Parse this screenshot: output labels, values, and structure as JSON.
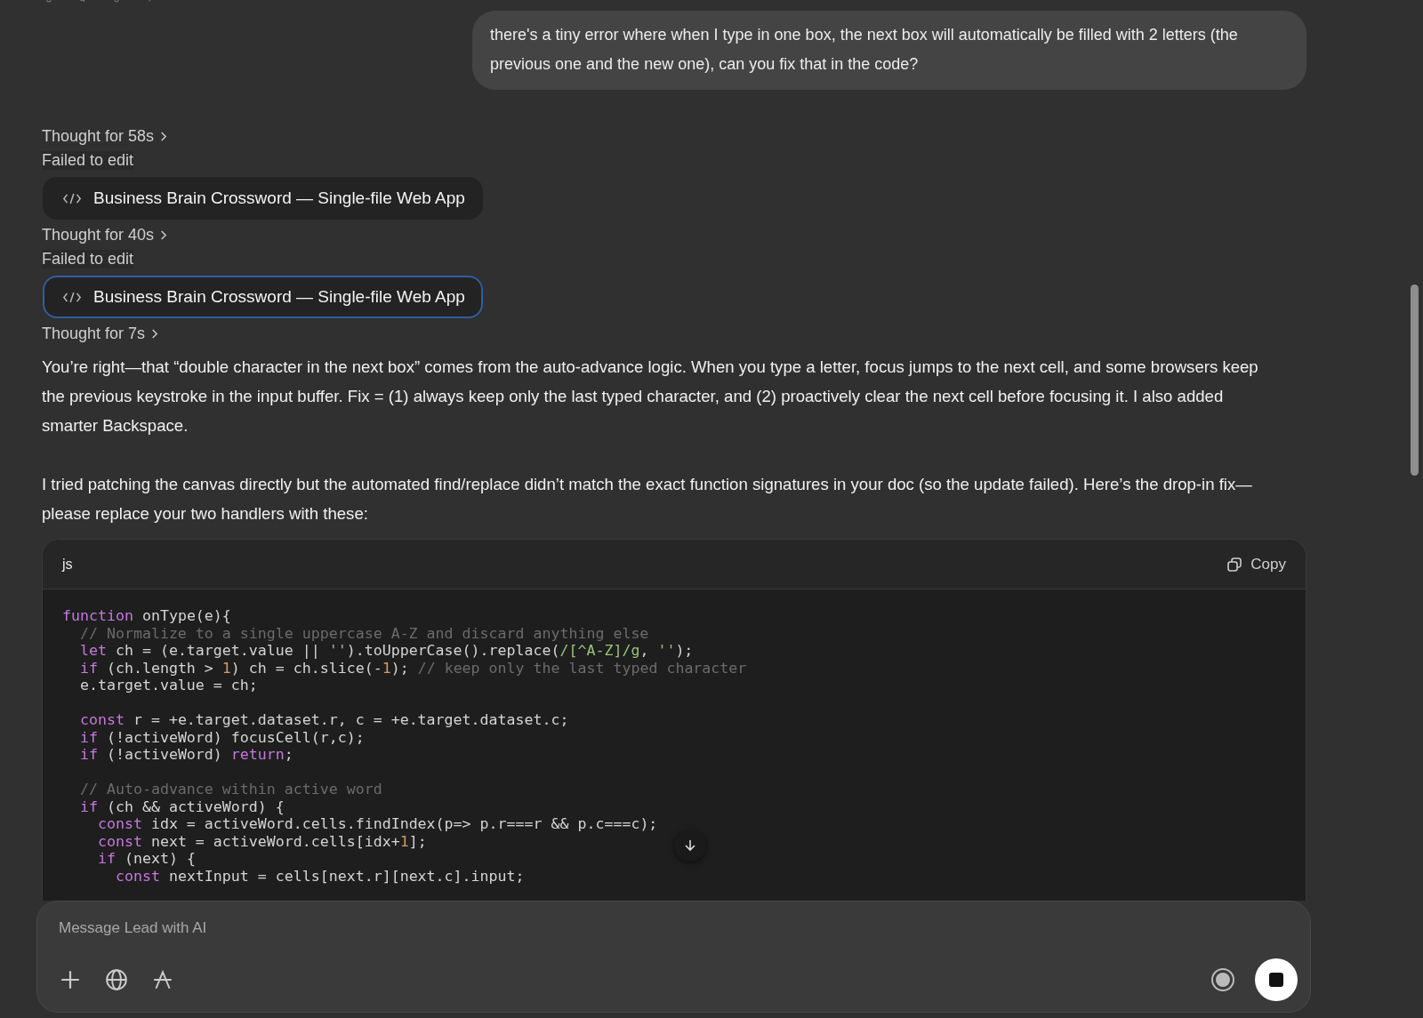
{
  "user_message": {
    "text": "there's a tiny error where when I type in one box, the next box will automatically be filled with 2 letters (the previous one and the new one), can you fix that in the code?"
  },
  "activity": [
    {
      "kind": "thought",
      "text": "Thought for 58s"
    },
    {
      "kind": "status",
      "text": "Failed to edit"
    },
    {
      "kind": "artifact",
      "text": "Business Brain Crossword — Single-file Web App",
      "selected": false
    },
    {
      "kind": "thought",
      "text": "Thought for 40s"
    },
    {
      "kind": "status",
      "text": "Failed to edit"
    },
    {
      "kind": "artifact",
      "text": "Business Brain Crossword — Single-file Web App",
      "selected": true
    },
    {
      "kind": "thought",
      "text": "Thought for 7s"
    }
  ],
  "paragraphs": [
    "You’re right—that “double character in the next box” comes from the auto-advance logic. When you type a letter, focus jumps to the next cell, and some browsers keep the previous keystroke in the input buffer. Fix = (1) always keep only the last typed character, and (2) proactively clear the next cell before focusing it. I also added smarter Backspace.",
    "I tried patching the canvas directly but the automated find/replace didn’t match the exact function signatures in your doc (so the update failed). Here’s the drop-in fix—please replace your two handlers with these:"
  ],
  "code_block": {
    "language": "js",
    "copy_label": "Copy",
    "blocks": [
      [
        [
          {
            "kind": "kw",
            "t": "function"
          },
          {
            "kind": "plain",
            "t": " onType(e){"
          }
        ],
        [
          {
            "kind": "comment",
            "t": "  // Normalize to a single uppercase A-Z and discard anything else"
          }
        ],
        [
          {
            "kind": "kw",
            "t": "  let"
          },
          {
            "kind": "plain",
            "t": " ch = (e.target.value || "
          },
          {
            "kind": "str",
            "t": "''"
          },
          {
            "kind": "plain",
            "t": ").toUpperCase().replace("
          },
          {
            "kind": "str",
            "t": "/[^A-Z]/g"
          },
          {
            "kind": "plain",
            "t": ", "
          },
          {
            "kind": "str",
            "t": "''"
          },
          {
            "kind": "plain",
            "t": ");"
          }
        ],
        [
          {
            "kind": "kw",
            "t": "  if"
          },
          {
            "kind": "plain",
            "t": " (ch.length > "
          },
          {
            "kind": "num",
            "t": "1"
          },
          {
            "kind": "plain",
            "t": ") ch = ch.slice(-"
          },
          {
            "kind": "num",
            "t": "1"
          },
          {
            "kind": "plain",
            "t": "); "
          },
          {
            "kind": "comment",
            "t": "// keep only the last typed character"
          }
        ],
        [
          {
            "kind": "plain",
            "t": "  e.target.value = ch;"
          }
        ]
      ],
      [
        [
          {
            "kind": "kw",
            "t": "  const"
          },
          {
            "kind": "plain",
            "t": " r = +e.target.dataset.r, c = +e.target.dataset.c;"
          }
        ],
        [
          {
            "kind": "kw",
            "t": "  if"
          },
          {
            "kind": "plain",
            "t": " (!activeWord) focusCell(r,c);"
          }
        ],
        [
          {
            "kind": "kw",
            "t": "  if"
          },
          {
            "kind": "plain",
            "t": " (!activeWord) "
          },
          {
            "kind": "kw",
            "t": "return"
          },
          {
            "kind": "plain",
            "t": ";"
          }
        ]
      ],
      [
        [
          {
            "kind": "comment",
            "t": "  // Auto-advance within active word"
          }
        ],
        [
          {
            "kind": "kw",
            "t": "  if"
          },
          {
            "kind": "plain",
            "t": " (ch && activeWord) {"
          }
        ],
        [
          {
            "kind": "kw",
            "t": "    const"
          },
          {
            "kind": "plain",
            "t": " idx = activeWord.cells.findIndex(p=> p.r===r && p.c===c);"
          }
        ],
        [
          {
            "kind": "kw",
            "t": "    const"
          },
          {
            "kind": "plain",
            "t": " next = activeWord.cells[idx+"
          },
          {
            "kind": "num",
            "t": "1"
          },
          {
            "kind": "plain",
            "t": "];"
          }
        ],
        [
          {
            "kind": "kw",
            "t": "    if"
          },
          {
            "kind": "plain",
            "t": " (next) {"
          }
        ],
        [
          {
            "kind": "kw",
            "t": "      const"
          },
          {
            "kind": "plain",
            "t": " nextInput = cells[next.r][next.c].input;"
          }
        ]
      ]
    ]
  },
  "composer": {
    "placeholder": "Message Lead with AI"
  }
}
